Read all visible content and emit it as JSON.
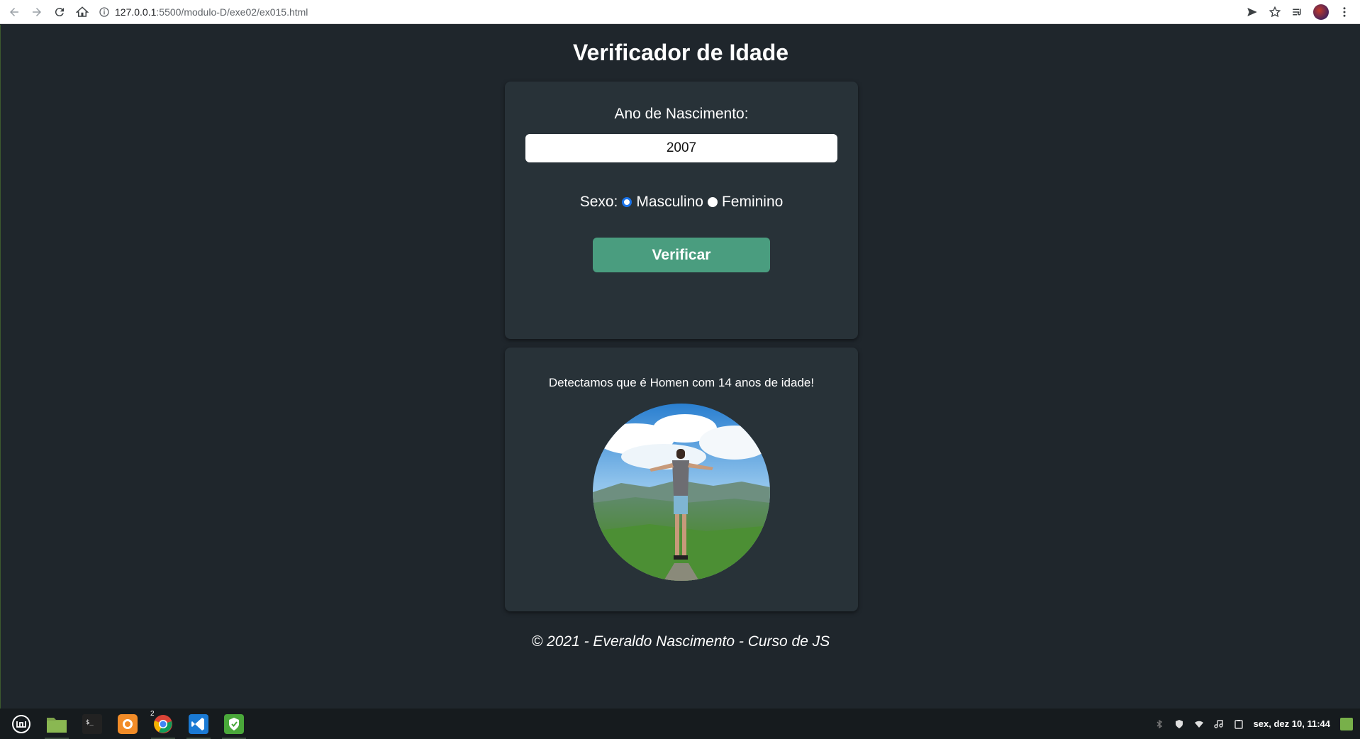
{
  "browser": {
    "url_host": "127.0.0.1",
    "url_path": ":5500/modulo-D/exe02/ex015.html"
  },
  "page": {
    "title": "Verificador de Idade",
    "form": {
      "year_label": "Ano de Nascimento:",
      "year_value": "2007",
      "sex_label": "Sexo:",
      "options": [
        {
          "label": "Masculino",
          "selected": true
        },
        {
          "label": "Feminino",
          "selected": false
        }
      ],
      "button_label": "Verificar"
    },
    "result": {
      "text": "Detectamos que é Homen com 14 anos de idade!"
    },
    "footer": "© 2021 - Everaldo Nascimento - Curso de JS"
  },
  "taskbar": {
    "apps": [
      "menu-icon",
      "files-icon",
      "terminal-icon",
      "firefox-icon",
      "chrome-icon",
      "vscode-icon",
      "shield-icon"
    ],
    "chrome_badge": "2",
    "clock": "sex, dez 10, 11:44"
  },
  "colors": {
    "background": "#1f262c",
    "card": "#283238",
    "button": "#4a9d7f",
    "radio_selected": "#1a73e8"
  }
}
